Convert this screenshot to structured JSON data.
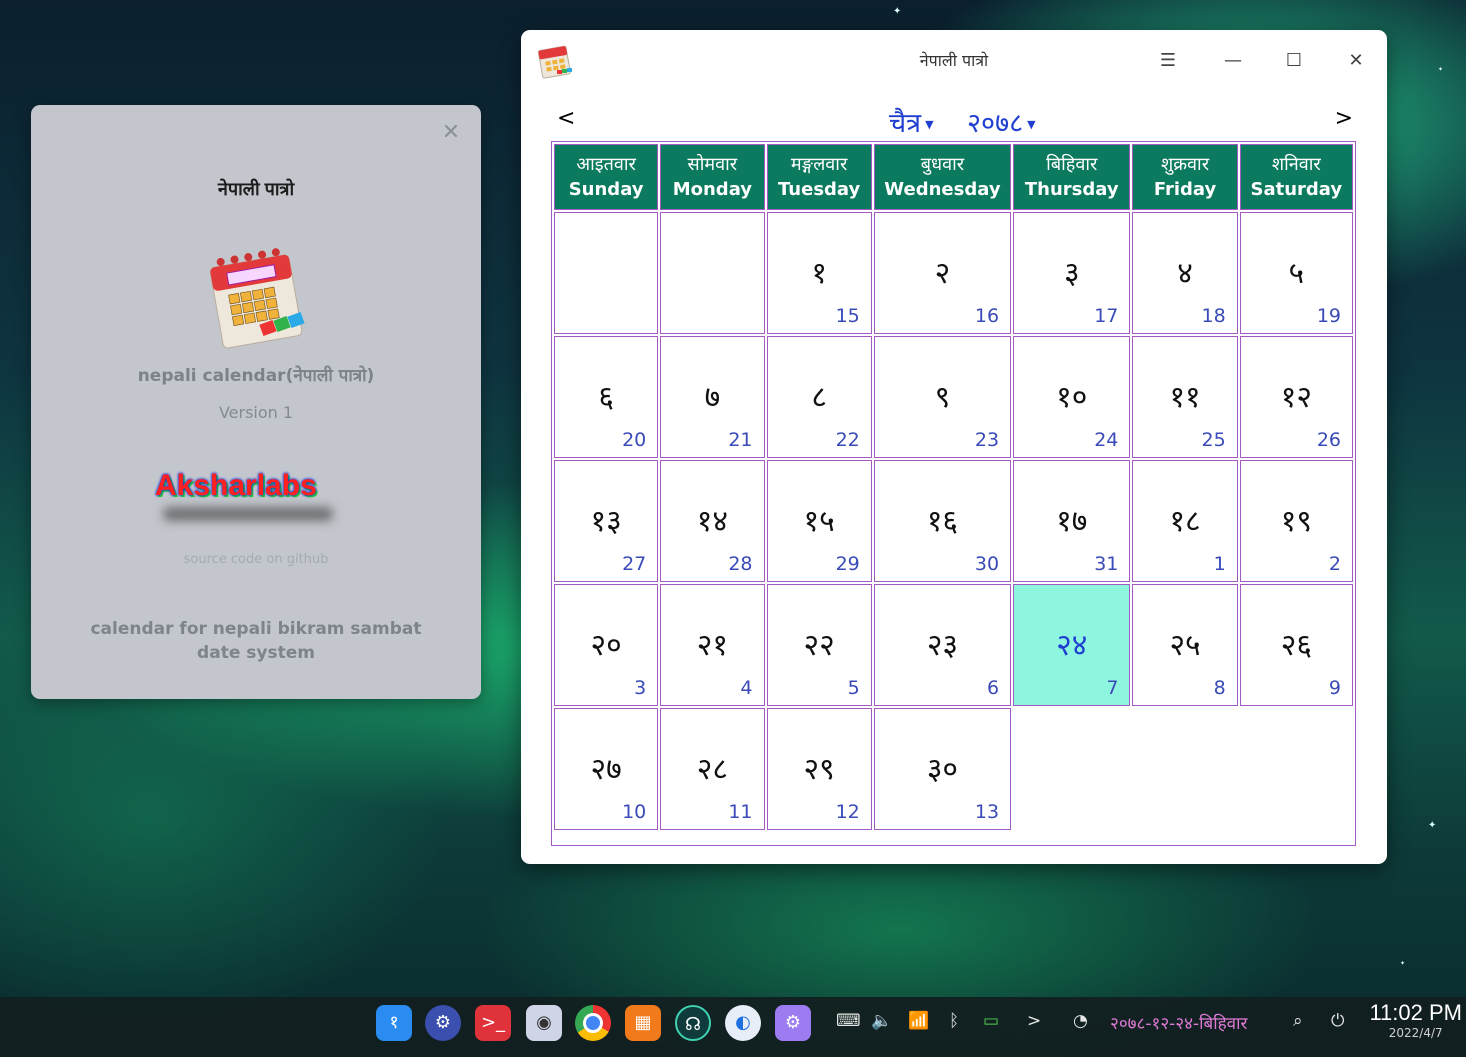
{
  "about": {
    "title": "नेपाली पात्रो",
    "app_name": "nepali calendar(नेपाली पात्रो)",
    "version": "Version 1",
    "logo_text": "Aksharlabs",
    "source_link": "source code on github",
    "description": "calendar for nepali bikram sambat date system"
  },
  "window": {
    "title": "नेपाली पात्रो",
    "prev": "<",
    "next": ">",
    "month": "चैत्र",
    "year": "२०७८",
    "menu_icon": "☰",
    "minimize_icon": "—",
    "maximize_icon": "☐",
    "close_icon": "✕"
  },
  "weekdays": [
    {
      "np": "आइतवार",
      "en": "Sunday"
    },
    {
      "np": "सोमवार",
      "en": "Monday"
    },
    {
      "np": "मङ्गलवार",
      "en": "Tuesday"
    },
    {
      "np": "बुधवार",
      "en": "Wednesday"
    },
    {
      "np": "बिहिवार",
      "en": "Thursday"
    },
    {
      "np": "शुक्रवार",
      "en": "Friday"
    },
    {
      "np": "शनिवार",
      "en": "Saturday"
    }
  ],
  "weeks": [
    [
      null,
      null,
      {
        "bs": "१",
        "ad": "15"
      },
      {
        "bs": "२",
        "ad": "16"
      },
      {
        "bs": "३",
        "ad": "17"
      },
      {
        "bs": "४",
        "ad": "18"
      },
      {
        "bs": "५",
        "ad": "19"
      }
    ],
    [
      {
        "bs": "६",
        "ad": "20"
      },
      {
        "bs": "७",
        "ad": "21"
      },
      {
        "bs": "८",
        "ad": "22"
      },
      {
        "bs": "९",
        "ad": "23"
      },
      {
        "bs": "१०",
        "ad": "24"
      },
      {
        "bs": "११",
        "ad": "25"
      },
      {
        "bs": "१२",
        "ad": "26"
      }
    ],
    [
      {
        "bs": "१३",
        "ad": "27"
      },
      {
        "bs": "१४",
        "ad": "28"
      },
      {
        "bs": "१५",
        "ad": "29"
      },
      {
        "bs": "१६",
        "ad": "30"
      },
      {
        "bs": "१७",
        "ad": "31"
      },
      {
        "bs": "१८",
        "ad": "1"
      },
      {
        "bs": "१९",
        "ad": "2"
      }
    ],
    [
      {
        "bs": "२०",
        "ad": "3"
      },
      {
        "bs": "२१",
        "ad": "4"
      },
      {
        "bs": "२२",
        "ad": "5"
      },
      {
        "bs": "२३",
        "ad": "6"
      },
      {
        "bs": "२४",
        "ad": "7",
        "today": true
      },
      {
        "bs": "२५",
        "ad": "8"
      },
      {
        "bs": "२६",
        "ad": "9"
      }
    ],
    [
      {
        "bs": "२७",
        "ad": "10"
      },
      {
        "bs": "२८",
        "ad": "11"
      },
      {
        "bs": "२९",
        "ad": "12"
      },
      {
        "bs": "३०",
        "ad": "13"
      },
      "tail",
      "tail",
      "tail"
    ]
  ],
  "taskbar": {
    "bs_date": "२०७८-१२-२४-बिहिवार",
    "time": "11:02 PM",
    "date": "2022/4/7",
    "tray_chevron": ">"
  },
  "colors": {
    "header_bg": "#0b7a5e",
    "today_bg": "#8ef6de",
    "accent_blue": "#1f3fd1",
    "cell_border": "#a35bc4"
  }
}
